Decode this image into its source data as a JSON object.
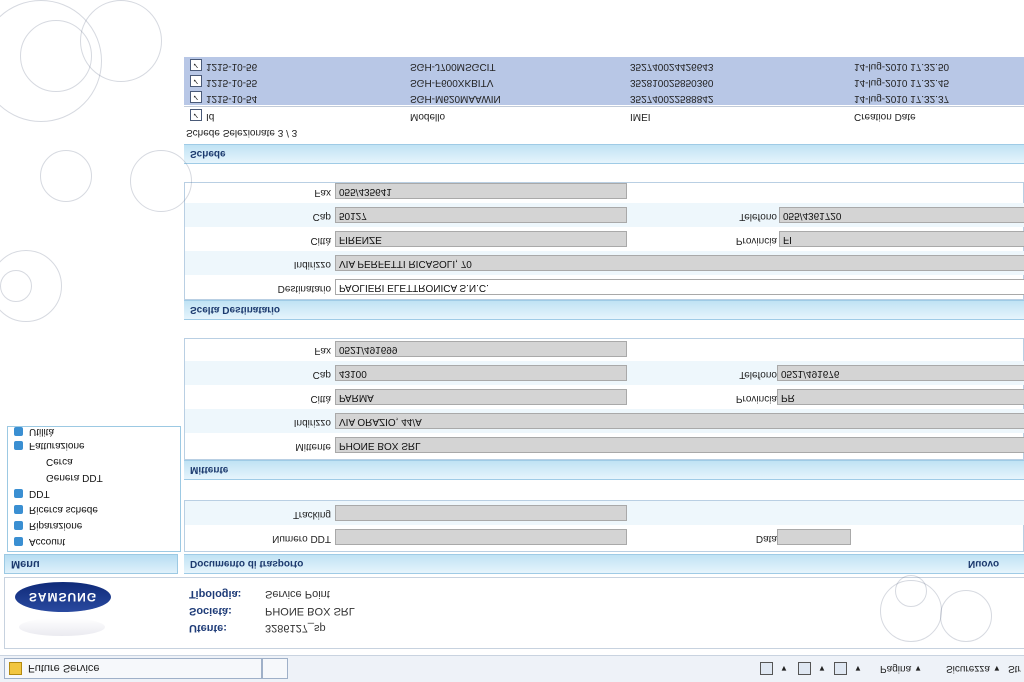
{
  "browser": {
    "tab_title": "Future Service",
    "status": {
      "pagina": "Pagina",
      "sicurezza": "Sicurezza",
      "strumenti": "Str"
    }
  },
  "footer": {
    "logo": "SAMSUNG",
    "tipologia_label": "Tipologia:",
    "tipologia_value": "Service Point",
    "societa_label": "Società:",
    "societa_value": "PHONE BOX SRL",
    "utente_label": "Utente:",
    "utente_value": "3286127_sp"
  },
  "menu": {
    "title": "Menu",
    "items": [
      "Account",
      "Riparazione",
      "Ricerca schede",
      "DDT"
    ],
    "subitems": [
      "Genera DDT",
      "Cerca"
    ],
    "items2": [
      "Fatturazione",
      "Utilità"
    ]
  },
  "ddt": {
    "title": "Documento di trasporto",
    "nuovo": "Nuovo",
    "numero_label": "Numero DDT",
    "numero_value": "",
    "data_label": "Data",
    "data_value": "",
    "tracking_label": "Tracking",
    "tracking_value": ""
  },
  "mittente": {
    "title": "Mittente",
    "mittente_label": "Mittente",
    "mittente_value": "PHONE BOX SRL",
    "indirizzo_label": "Indirizzo",
    "indirizzo_value": "VIA ORAZIO, 44/A",
    "citta_label": "Città",
    "citta_value": "PARMA",
    "provincia_label": "Provincia",
    "provincia_value": "PR",
    "cap_label": "Cap",
    "cap_value": "43100",
    "telefono_label": "Telefono",
    "telefono_value": "0521/491676",
    "fax_label": "Fax",
    "fax_value": "0521/491699"
  },
  "destinatario": {
    "title": "Scelta Destinatario",
    "dest_label": "Destinatario",
    "dest_value": "PAOLIERI ELETTRONICA S.N.C.",
    "indirizzo_label": "Indirizzo",
    "indirizzo_value": "VIA PERFETTI RICASOLI, 70",
    "citta_label": "Città",
    "citta_value": "FIRENZE",
    "provincia_label": "Provincia",
    "provincia_value": "FI",
    "cap_label": "Cap",
    "cap_value": "50127",
    "telefono_label": "Telefono",
    "telefono_value": "055/4361720",
    "fax_label": "Fax",
    "fax_value": "055/435641"
  },
  "schede": {
    "title": "Schede",
    "selected_text": "Schede Selezionate 3 / 3",
    "headers": [
      "Id",
      "Modello",
      "IMEI",
      "Creation Date"
    ],
    "rows": [
      {
        "id": "1215-10-54",
        "modello": "SGH-M620MAAWIN",
        "imei": "352740022588842",
        "date": "14-lug-2010 17.32.37"
      },
      {
        "id": "1215-10-55",
        "modello": "SGH-F600XKBITV",
        "imei": "352810025850360",
        "date": "14-lug-2010 17.32.45"
      },
      {
        "id": "1215-10-56",
        "modello": "SGH-J700MSGCIT",
        "imei": "352740024426643",
        "date": "14-lug-2010 17.32.50"
      }
    ]
  }
}
